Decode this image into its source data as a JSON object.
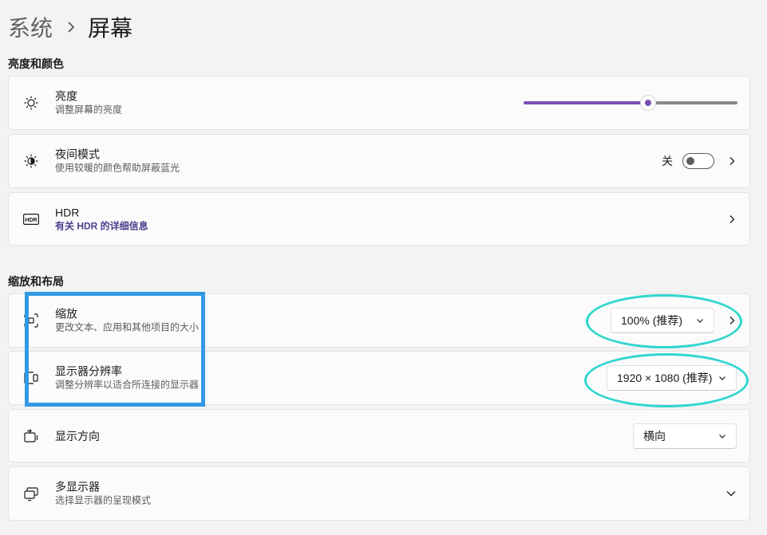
{
  "breadcrumb": {
    "parent": "系统",
    "current": "屏幕"
  },
  "sections": {
    "brightness_color": "亮度和颜色",
    "scale_layout": "缩放和布局"
  },
  "brightness": {
    "title": "亮度",
    "subtitle": "调整屏幕的亮度",
    "level": 0.59,
    "accent": "#7b4fb5"
  },
  "night_light": {
    "title": "夜间模式",
    "subtitle": "使用较暖的颜色帮助屏蔽蓝光",
    "state_label": "关",
    "on": false
  },
  "hdr": {
    "icon_text": "HDR",
    "title": "HDR",
    "link": "有关 HDR 的详细信息"
  },
  "scale": {
    "title": "缩放",
    "subtitle": "更改文本、应用和其他项目的大小",
    "value": "100% (推荐)"
  },
  "resolution": {
    "title": "显示器分辨率",
    "subtitle": "调整分辨率以适合所连接的显示器",
    "value": "1920 × 1080 (推荐)"
  },
  "orientation": {
    "title": "显示方向",
    "value": "横向"
  },
  "multi_display": {
    "title": "多显示器",
    "subtitle": "选择显示器的呈现模式"
  },
  "annotations": {
    "rect_color": "#3399e6",
    "ellipse_color": "#2fd6d0"
  }
}
